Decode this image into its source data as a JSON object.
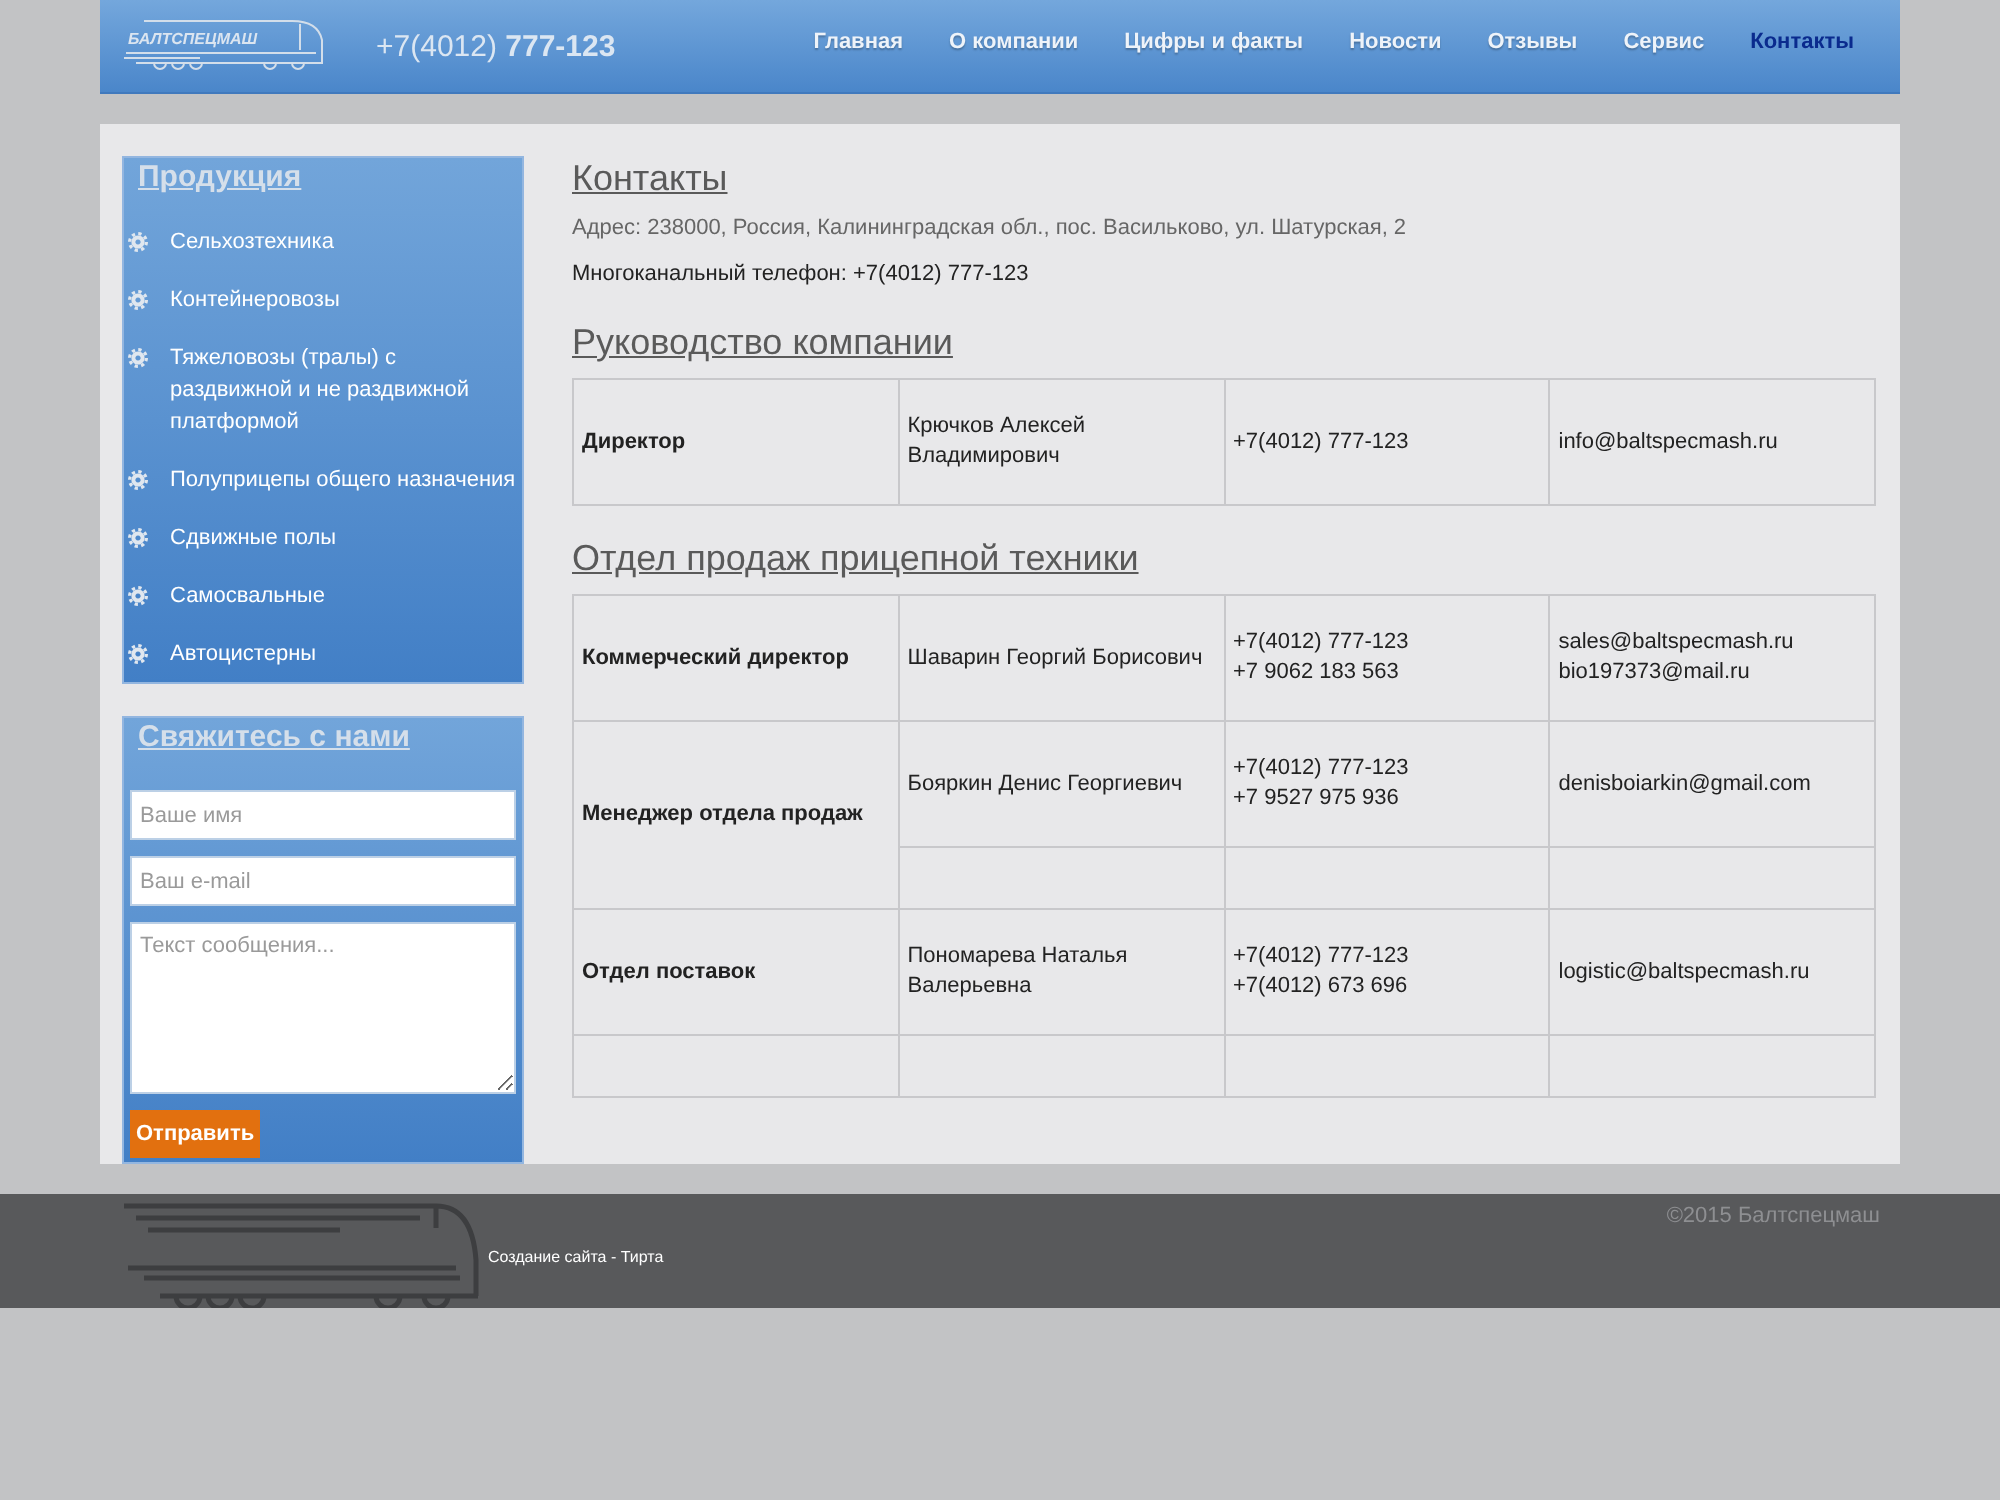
{
  "header": {
    "logo_text": "БАЛТСПЕЦМАШ",
    "phone": "+7(4012) **777-123**",
    "nav": [
      {
        "label": "Главная",
        "selected": false
      },
      {
        "label": "О компании",
        "selected": false
      },
      {
        "label": "Цифры и факты",
        "selected": false
      },
      {
        "label": "Новости",
        "selected": false
      },
      {
        "label": "Отзывы",
        "selected": false
      },
      {
        "label": "Сервис",
        "selected": false
      },
      {
        "label": "Контакты",
        "selected": true
      }
    ]
  },
  "sidebar": {
    "products": {
      "title": "Продукция",
      "items": [
        "Сельхозтехника",
        "Контейнеровозы",
        "Тяжеловозы (тралы) с раздвижной и не раздвижной платформой",
        "Полуприцепы общего назначения",
        "Сдвижные полы",
        "Самосвальные",
        "Автоцистерны"
      ]
    },
    "contact_form": {
      "title": "Свяжитесь с нами",
      "fields": [
        {
          "kind": "input",
          "placeholder": "Ваше имя"
        },
        {
          "kind": "input",
          "placeholder": "Ваш e-mail"
        },
        {
          "kind": "textarea",
          "placeholder": "Текст сообщения..."
        }
      ],
      "submit": "Отправить"
    }
  },
  "content": {
    "title": "Контакты",
    "address": "Адрес: 238000, Россия, Калининградская обл., пос. Васильково, ул. Шатурская, 2",
    "phone": "Многоканальный телефон: +7(4012) 777-123",
    "sections": [
      {
        "title": "Руководство компании",
        "rows": [
          {
            "kind": "entry",
            "position": "Директор",
            "contacts": [
              {
                "kind": "entry",
                "name": "Крючков Алексей Владимирович",
                "phones": [
                  "+7(4012) 777-123"
                ],
                "emails": [
                  "info@baltspecmash.ru"
                ]
              }
            ]
          }
        ]
      },
      {
        "title": "Отдел продаж прицепной техники",
        "rows": [
          {
            "kind": "entry",
            "position": "Коммерческий директор",
            "contacts": [
              {
                "kind": "entry",
                "name": "Шаварин Георгий Борисович",
                "phones": [
                  "+7(4012) 777-123",
                  "+7 9062 183 563"
                ],
                "emails": [
                  "sales@baltspecmash.ru",
                  "bio197373@mail.ru"
                ]
              }
            ]
          },
          {
            "kind": "entry",
            "position": "Менеджер отдела продаж",
            "contacts": [
              {
                "kind": "entry",
                "name": "Бояркин Денис Георгиевич",
                "phones": [
                  "+7(4012) 777-123",
                  "+7 9527 975 936"
                ],
                "emails": [
                  "denisboiarkin@gmail.com"
                ]
              },
              {
                "kind": "blank"
              }
            ]
          },
          {
            "kind": "entry",
            "position": "Отдел поставок",
            "contacts": [
              {
                "kind": "entry",
                "name": "Пономарева Наталья Валерьевна",
                "phones": [
                  "+7(4012) 777-123",
                  "+7(4012) 673 696"
                ],
                "emails": [
                  "logistic@baltspecmash.ru"
                ]
              }
            ]
          },
          {
            "kind": "blank"
          }
        ]
      }
    ]
  },
  "footer": {
    "credit": "Создание сайта - Тирта",
    "copyright": "©2015 Балтспецмаш"
  }
}
